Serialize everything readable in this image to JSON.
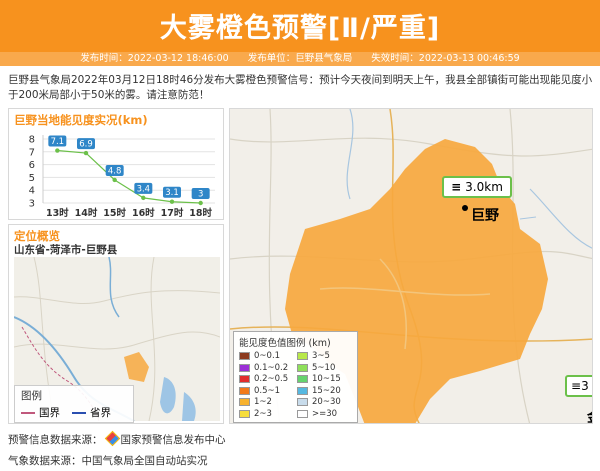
{
  "header": {
    "title": "大雾橙色预警[Ⅱ/严重]",
    "publish_time": "发布时间：2022-03-12 18:46:00",
    "publisher": "发布单位：巨野县气象局",
    "expire_time": "失效时间：2022-03-13 00:46:59"
  },
  "intro": "巨野县气象局2022年03月12日18时46分发布大雾橙色预警信号：预计今天夜间到明天上午，我县全部镇街可能出现能见度小于200米局部小于50米的雾。请注意防范！",
  "visibility_panel": {
    "title": "巨野当地能见度实况(km)"
  },
  "chart_data": {
    "type": "line",
    "title": "巨野当地能见度实况(km)",
    "categories": [
      "13时",
      "14时",
      "15时",
      "16时",
      "17时",
      "18时"
    ],
    "values": [
      7.1,
      6.9,
      4.8,
      3.4,
      3.1,
      3
    ],
    "y_ticks": [
      3,
      4,
      5,
      6,
      7,
      8
    ],
    "ylim": [
      3,
      8
    ],
    "grid": true,
    "colors": {
      "line": "#6cc04a",
      "label_bg": "#2f86c8"
    }
  },
  "location_panel": {
    "title": "定位概览",
    "region": "山东省-菏泽市-巨野县",
    "legend": {
      "title": "图例",
      "items": [
        {
          "label": "国界",
          "color": "#c0587c"
        },
        {
          "label": "省界",
          "color": "#2a4fb0"
        }
      ]
    }
  },
  "main_map": {
    "city_label": "巨野",
    "callout_value": "3.0km",
    "callout_value_2": "3",
    "city_label_2": "金",
    "legend": {
      "title": "能见度色值图例 (km)",
      "items": [
        {
          "label": "0~0.1",
          "color": "#8c3a1e"
        },
        {
          "label": "3~5",
          "color": "#b8e84a"
        },
        {
          "label": "0.1~0.2",
          "color": "#9b2fd6"
        },
        {
          "label": "5~10",
          "color": "#8ee05a"
        },
        {
          "label": "0.2~0.5",
          "color": "#e12d2d"
        },
        {
          "label": "10~15",
          "color": "#66d36e"
        },
        {
          "label": "0.5~1",
          "color": "#f27a1a"
        },
        {
          "label": "15~20",
          "color": "#56b8e0"
        },
        {
          "label": "1~2",
          "color": "#f7b22e"
        },
        {
          "label": "20~30",
          "color": "#c8dceb"
        },
        {
          "label": "2~3",
          "color": "#f6dd3c"
        },
        {
          "label": ">=30",
          "color": "#ffffff"
        }
      ]
    }
  },
  "footer": {
    "source_label": "预警信息数据来源：",
    "source_name": "国家预警信息发布中心",
    "data_label": "气象数据来源：中国气象局全国自动站实况"
  }
}
